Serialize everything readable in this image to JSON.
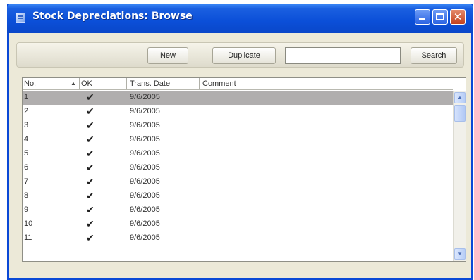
{
  "window": {
    "title": "Stock Depreciations: Browse",
    "controls": {
      "minimize": "minimize",
      "maximize": "maximize",
      "close": "✕"
    }
  },
  "toolbar": {
    "new_label": "New",
    "duplicate_label": "Duplicate",
    "search_value": "",
    "search_label": "Search"
  },
  "table": {
    "columns": [
      "No.",
      "OK",
      "Trans. Date",
      "Comment"
    ],
    "sort_indicator": "▲",
    "rows": [
      {
        "no": "1",
        "ok": "✔",
        "date": "9/6/2005",
        "comment": ""
      },
      {
        "no": "2",
        "ok": "✔",
        "date": "9/6/2005",
        "comment": ""
      },
      {
        "no": "3",
        "ok": "✔",
        "date": "9/6/2005",
        "comment": ""
      },
      {
        "no": "4",
        "ok": "✔",
        "date": "9/6/2005",
        "comment": ""
      },
      {
        "no": "5",
        "ok": "✔",
        "date": "9/6/2005",
        "comment": ""
      },
      {
        "no": "6",
        "ok": "✔",
        "date": "9/6/2005",
        "comment": ""
      },
      {
        "no": "7",
        "ok": "✔",
        "date": "9/6/2005",
        "comment": ""
      },
      {
        "no": "8",
        "ok": "✔",
        "date": "9/6/2005",
        "comment": ""
      },
      {
        "no": "9",
        "ok": "✔",
        "date": "9/6/2005",
        "comment": ""
      },
      {
        "no": "10",
        "ok": "✔",
        "date": "9/6/2005",
        "comment": ""
      },
      {
        "no": "11",
        "ok": "✔",
        "date": "9/6/2005",
        "comment": ""
      }
    ]
  },
  "scrollbar": {
    "up": "▲",
    "down": "▼"
  }
}
